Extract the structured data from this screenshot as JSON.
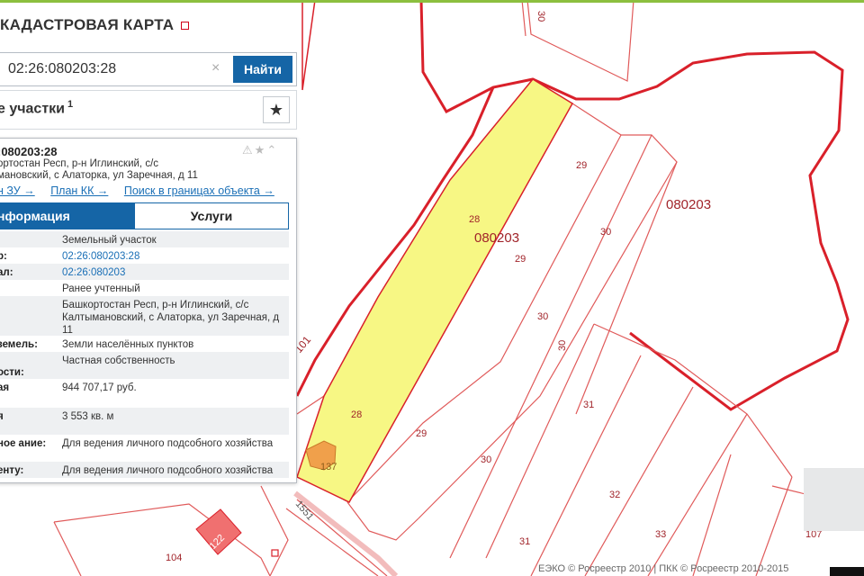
{
  "app": {
    "title": "КАДАСТРОВАЯ КАРТА"
  },
  "search": {
    "value": "02:26:080203:28",
    "button_label": "Найти",
    "clear_icon": "×"
  },
  "results": {
    "label": "е участки",
    "count": "1"
  },
  "card": {
    "number": ":080203:28",
    "address_line1": "ортостан Респ, р-н Иглинский, с/с",
    "address_line2": "мановский, с Алаторка, ул Заречная, д 11",
    "links": [
      "н ЗУ →",
      "План КК →",
      "Поиск в границах объекта →"
    ],
    "tab_info": "нформация",
    "tab_services": "Услуги",
    "rows": [
      {
        "key": "",
        "value": "Земельный участок"
      },
      {
        "key": "р:",
        "value": "02:26:080203:28"
      },
      {
        "key": "ал:",
        "value": "02:26:080203"
      },
      {
        "key": "",
        "value": "Ранее учтенный"
      },
      {
        "key": "",
        "value": "Башкортостан Респ, р-н Иглинский, с/с Калтымановский, с Алаторка, ул Заречная, д 11"
      },
      {
        "key": "земель:",
        "value": "Земли населённых пунктов"
      },
      {
        "key": "ости:",
        "value": "Частная собственность"
      },
      {
        "key": "ая",
        "value": "944 707,17 руб."
      },
      {
        "key": "я",
        "value": "3 553 кв. м"
      },
      {
        "key": "ное ание:",
        "value": "Для ведения личного подсобного хозяйства"
      },
      {
        "key": "енту:",
        "value": "Для ведения личного подсобного хозяйства"
      }
    ]
  },
  "map": {
    "labels": [
      {
        "text": "30"
      },
      {
        "text": "29"
      },
      {
        "text": "080203"
      },
      {
        "text": "28"
      },
      {
        "text": "080203"
      },
      {
        "text": "29"
      },
      {
        "text": "30"
      },
      {
        "text": "30"
      },
      {
        "text": "30"
      },
      {
        "text": "31"
      },
      {
        "text": "28"
      },
      {
        "text": "29"
      },
      {
        "text": "30"
      },
      {
        "text": "32"
      },
      {
        "text": "33"
      },
      {
        "text": "31"
      },
      {
        "text": "107"
      },
      {
        "text": "104"
      },
      {
        "text": "122"
      },
      {
        "text": "137"
      },
      {
        "text": "101"
      },
      {
        "text": "1551"
      }
    ],
    "attribution": "ЕЭКО © Росреестр 2010 | ПКК © Росреестр 2010-2015",
    "colors": {
      "boundary": "#d9202a",
      "parcel_lines": "#e05a5a",
      "highlight_fill": "#f7f784",
      "building": "#f0a04b",
      "accent": "#1565a6"
    }
  }
}
